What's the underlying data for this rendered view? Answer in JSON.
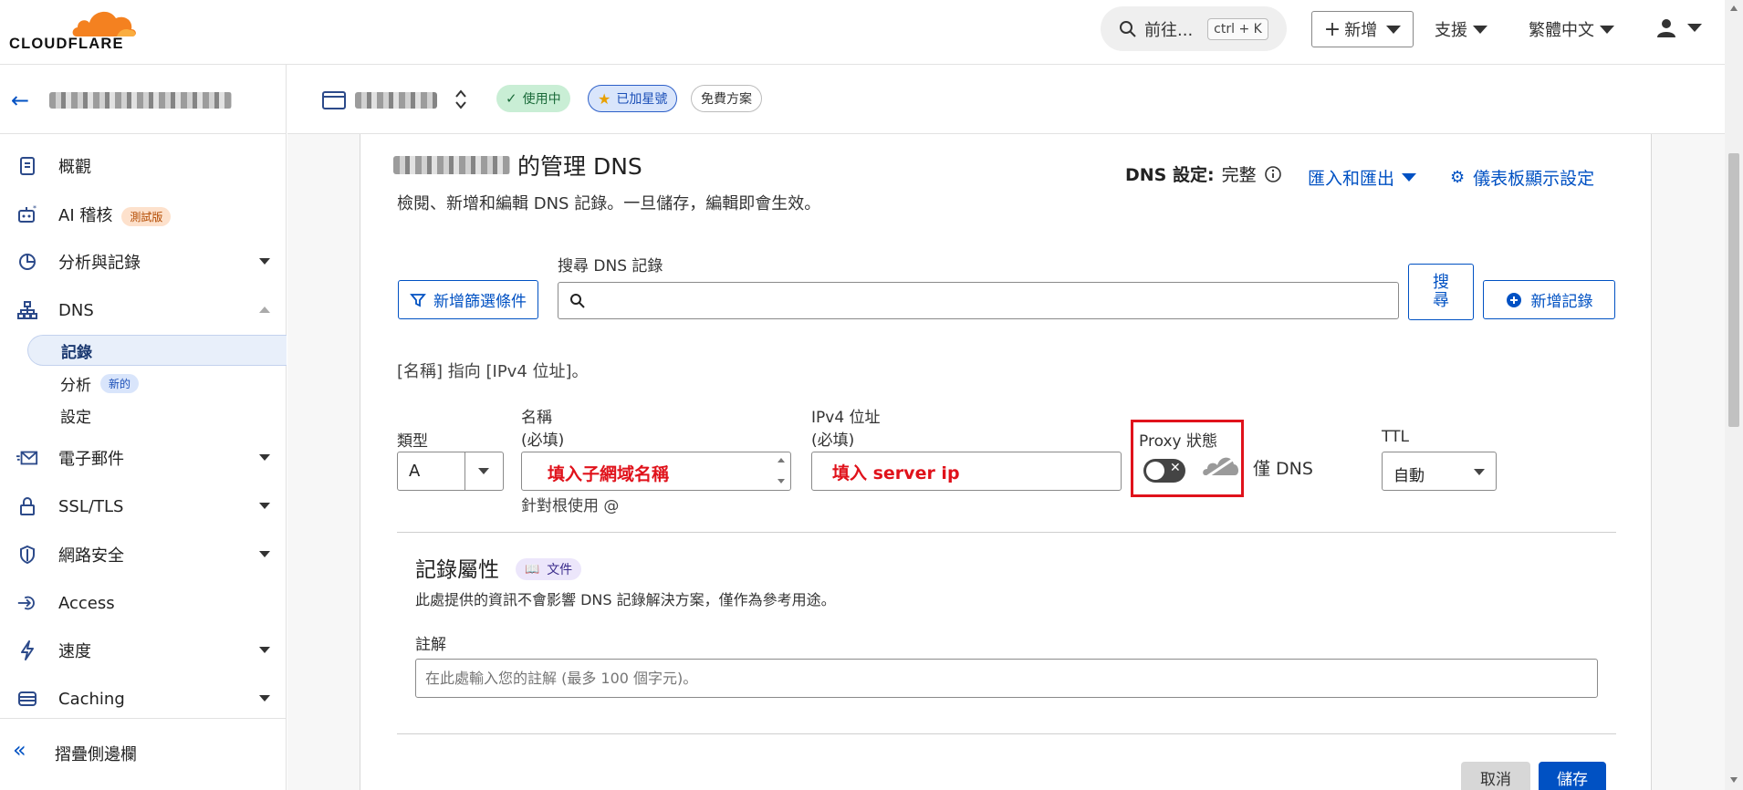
{
  "brand": {
    "name": "CLOUDFLARE",
    "color": "#f48120"
  },
  "topbar": {
    "goto_label": "前往...",
    "shortcut": "ctrl + K",
    "add_label": "新增",
    "support_label": "支援",
    "language_label": "繁體中文"
  },
  "zone": {
    "status_active": "使用中",
    "status_starred": "已加星號",
    "plan": "免費方案"
  },
  "sidebar": {
    "items": [
      {
        "label": "概觀",
        "icon": "document-icon"
      },
      {
        "label": "AI 稽核",
        "icon": "robot-icon",
        "badge": "測試版"
      },
      {
        "label": "分析與記錄",
        "icon": "pie-chart-icon"
      },
      {
        "label": "DNS",
        "icon": "network-icon"
      },
      {
        "label": "電子郵件",
        "icon": "mail-icon"
      },
      {
        "label": "SSL/TLS",
        "icon": "lock-icon"
      },
      {
        "label": "網路安全",
        "icon": "shield-icon"
      },
      {
        "label": "Access",
        "icon": "access-icon"
      },
      {
        "label": "速度",
        "icon": "lightning-icon"
      },
      {
        "label": "Caching",
        "icon": "server-icon"
      }
    ],
    "dns_sub": [
      {
        "label": "記錄",
        "active": true
      },
      {
        "label": "分析",
        "badge": "新的"
      },
      {
        "label": "設定"
      }
    ],
    "collapse_label": "摺疊側邊欄"
  },
  "main": {
    "title_suffix": "的管理 DNS",
    "description": "檢閱、新增和編輯 DNS 記錄。一旦儲存，編輯即會生效。",
    "dns_setup_label": "DNS 設定:",
    "dns_setup_value": "完整",
    "import_export": "匯入和匯出",
    "dashboard_settings": "儀表板顯示設定",
    "filter_button": "新增篩選條件",
    "search_label": "搜尋 DNS 記錄",
    "search_button": "搜尋",
    "add_record": "新增記錄",
    "hint": "[名稱] 指向 [IPv4 位址]。",
    "form": {
      "type_label": "類型",
      "type_value": "A",
      "name_label": "名稱",
      "name_required": "(必填)",
      "name_value": "填入子網域名稱",
      "name_help": "針對根使用 @",
      "ip_label": "IPv4 位址",
      "ip_required": "(必填)",
      "ip_value": "填入 server ip",
      "proxy_label": "Proxy 狀態",
      "proxy_on": false,
      "proxy_text": "僅 DNS",
      "ttl_label": "TTL",
      "ttl_value": "自動"
    },
    "attributes": {
      "title": "記錄屬性",
      "doc_label": "文件",
      "description": "此處提供的資訊不會影響 DNS 記錄解決方案，僅作為參考用途。",
      "comment_label": "註解",
      "comment_placeholder": "在此處輸入您的註解 (最多 100 個字元)。"
    },
    "cancel": "取消",
    "save": "儲存"
  }
}
